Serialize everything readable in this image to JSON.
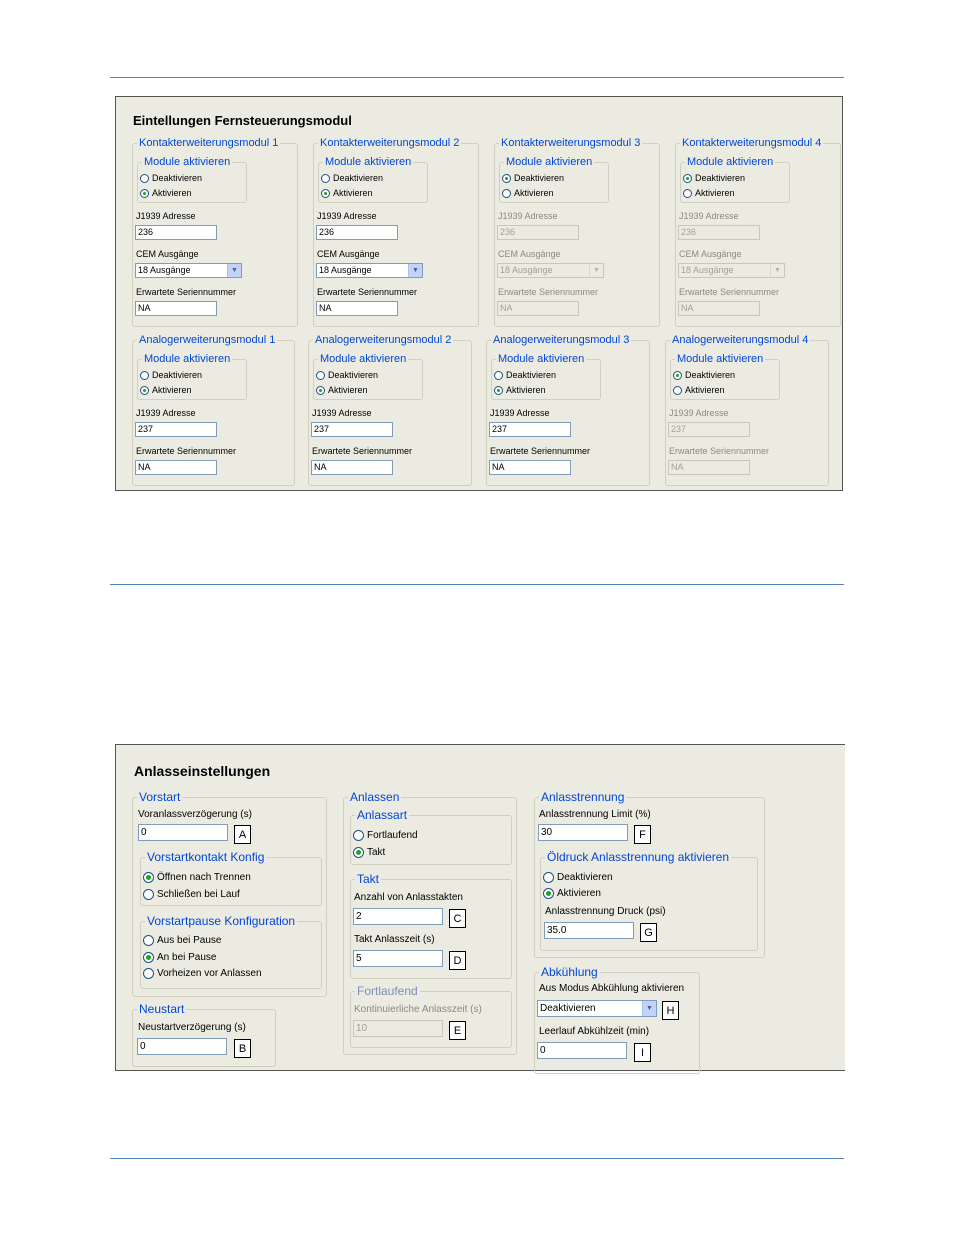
{
  "fern": {
    "title": "Eintellungen Fernsteuerungsmodul",
    "contact_modules": [
      {
        "title": "Kontakterweiterungsmodul 1",
        "enable_group": "Module aktivieren",
        "opt_off": "Deaktivieren",
        "opt_on": "Aktivieren",
        "selected": "Aktivieren",
        "addr_label": "J1939 Adresse",
        "addr": "236",
        "cem_label": "CEM Ausgänge",
        "cem": "18 Ausgänge",
        "serial_label": "Erwartete Seriennummer",
        "serial": "NA"
      },
      {
        "title": "Kontakterweiterungsmodul 2",
        "enable_group": "Module aktivieren",
        "opt_off": "Deaktivieren",
        "opt_on": "Aktivieren",
        "selected": "Aktivieren",
        "addr_label": "J1939 Adresse",
        "addr": "236",
        "cem_label": "CEM Ausgänge",
        "cem": "18 Ausgänge",
        "serial_label": "Erwartete Seriennummer",
        "serial": "NA"
      },
      {
        "title": "Kontakterweiterungsmodul 3",
        "enable_group": "Module aktivieren",
        "opt_off": "Deaktivieren",
        "opt_on": "Aktivieren",
        "selected": "Deaktivieren",
        "addr_label": "J1939 Adresse",
        "addr": "236",
        "cem_label": "CEM Ausgänge",
        "cem": "18 Ausgänge",
        "serial_label": "Erwartete Seriennummer",
        "serial": "NA"
      },
      {
        "title": "Kontakterweiterungsmodul 4",
        "enable_group": "Module aktivieren",
        "opt_off": "Deaktivieren",
        "opt_on": "Aktivieren",
        "selected": "Deaktivieren",
        "addr_label": "J1939 Adresse",
        "addr": "236",
        "cem_label": "CEM Ausgänge",
        "cem": "18 Ausgänge",
        "serial_label": "Erwartete Seriennummer",
        "serial": "NA"
      }
    ],
    "analog_modules": [
      {
        "title": "Analogerweiterungsmodul 1",
        "enable_group": "Module aktivieren",
        "opt_off": "Deaktivieren",
        "opt_on": "Aktivieren",
        "selected": "Aktivieren",
        "addr_label": "J1939 Adresse",
        "addr": "237",
        "serial_label": "Erwartete Seriennummer",
        "serial": "NA"
      },
      {
        "title": "Analogerweiterungsmodul 2",
        "enable_group": "Module aktivieren",
        "opt_off": "Deaktivieren",
        "opt_on": "Aktivieren",
        "selected": "Aktivieren",
        "addr_label": "J1939 Adresse",
        "addr": "237",
        "serial_label": "Erwartete Seriennummer",
        "serial": "NA"
      },
      {
        "title": "Analogerweiterungsmodul 3",
        "enable_group": "Module aktivieren",
        "opt_off": "Deaktivieren",
        "opt_on": "Aktivieren",
        "selected": "Aktivieren",
        "addr_label": "J1939 Adresse",
        "addr": "237",
        "serial_label": "Erwartete Seriennummer",
        "serial": "NA"
      },
      {
        "title": "Analogerweiterungsmodul 4",
        "enable_group": "Module aktivieren",
        "opt_off": "Deaktivieren",
        "opt_on": "Aktivieren",
        "selected": "Deaktivieren",
        "addr_label": "J1939 Adresse",
        "addr": "237",
        "serial_label": "Erwartete Seriennummer",
        "serial": "NA"
      }
    ]
  },
  "anlass": {
    "title": "Anlasseinstellungen",
    "vorstart": {
      "title": "Vorstart",
      "delay_label": "Voranlassverzögerung (s)",
      "delay": "0",
      "tag": "A",
      "konfig_title": "Vorstartkontakt Konfig",
      "konfig_opt1": "Öffnen nach Trennen",
      "konfig_opt2": "Schließen bei Lauf",
      "konfig_selected": 1,
      "pause_title": "Vorstartpause Konfiguration",
      "pause_opt1": "Aus bei Pause",
      "pause_opt2": "An bei Pause",
      "pause_opt3": "Vorheizen vor Anlassen",
      "pause_selected": 2
    },
    "neustart": {
      "title": "Neustart",
      "delay_label": "Neustartverzögerung (s)",
      "delay": "0",
      "tag": "B"
    },
    "anlassen": {
      "title": "Anlassen",
      "art_title": "Anlassart",
      "art_opt1": "Fortlaufend",
      "art_opt2": "Takt",
      "art_selected": 2,
      "takt_title": "Takt",
      "count_label": "Anzahl von Anlasstakten",
      "count": "2",
      "count_tag": "C",
      "time_label": "Takt Anlasszeit (s)",
      "time": "5",
      "time_tag": "D",
      "cont_title": "Fortlaufend",
      "cont_label": "Kontinuierliche Anlasszeit (s)",
      "cont": "10",
      "cont_tag": "E"
    },
    "trennung": {
      "title": "Anlasstrennung",
      "limit_label": "Anlasstrennung Limit (%)",
      "limit": "30",
      "limit_tag": "F",
      "oil_title": "Öldruck Anlasstrennung aktivieren",
      "oil_opt1": "Deaktivieren",
      "oil_opt2": "Aktivieren",
      "oil_selected": 2,
      "pressure_label": "Anlasstrennung Druck (psi)",
      "pressure": "35.0",
      "pressure_tag": "G"
    },
    "abkuehlung": {
      "title": "Abkühlung",
      "mode_label": "Aus Modus Abkühlung aktivieren",
      "mode": "Deaktivieren",
      "mode_tag": "H",
      "idle_label": "Leerlauf Abkühlzeit (min)",
      "idle": "0",
      "idle_tag": "I"
    }
  }
}
